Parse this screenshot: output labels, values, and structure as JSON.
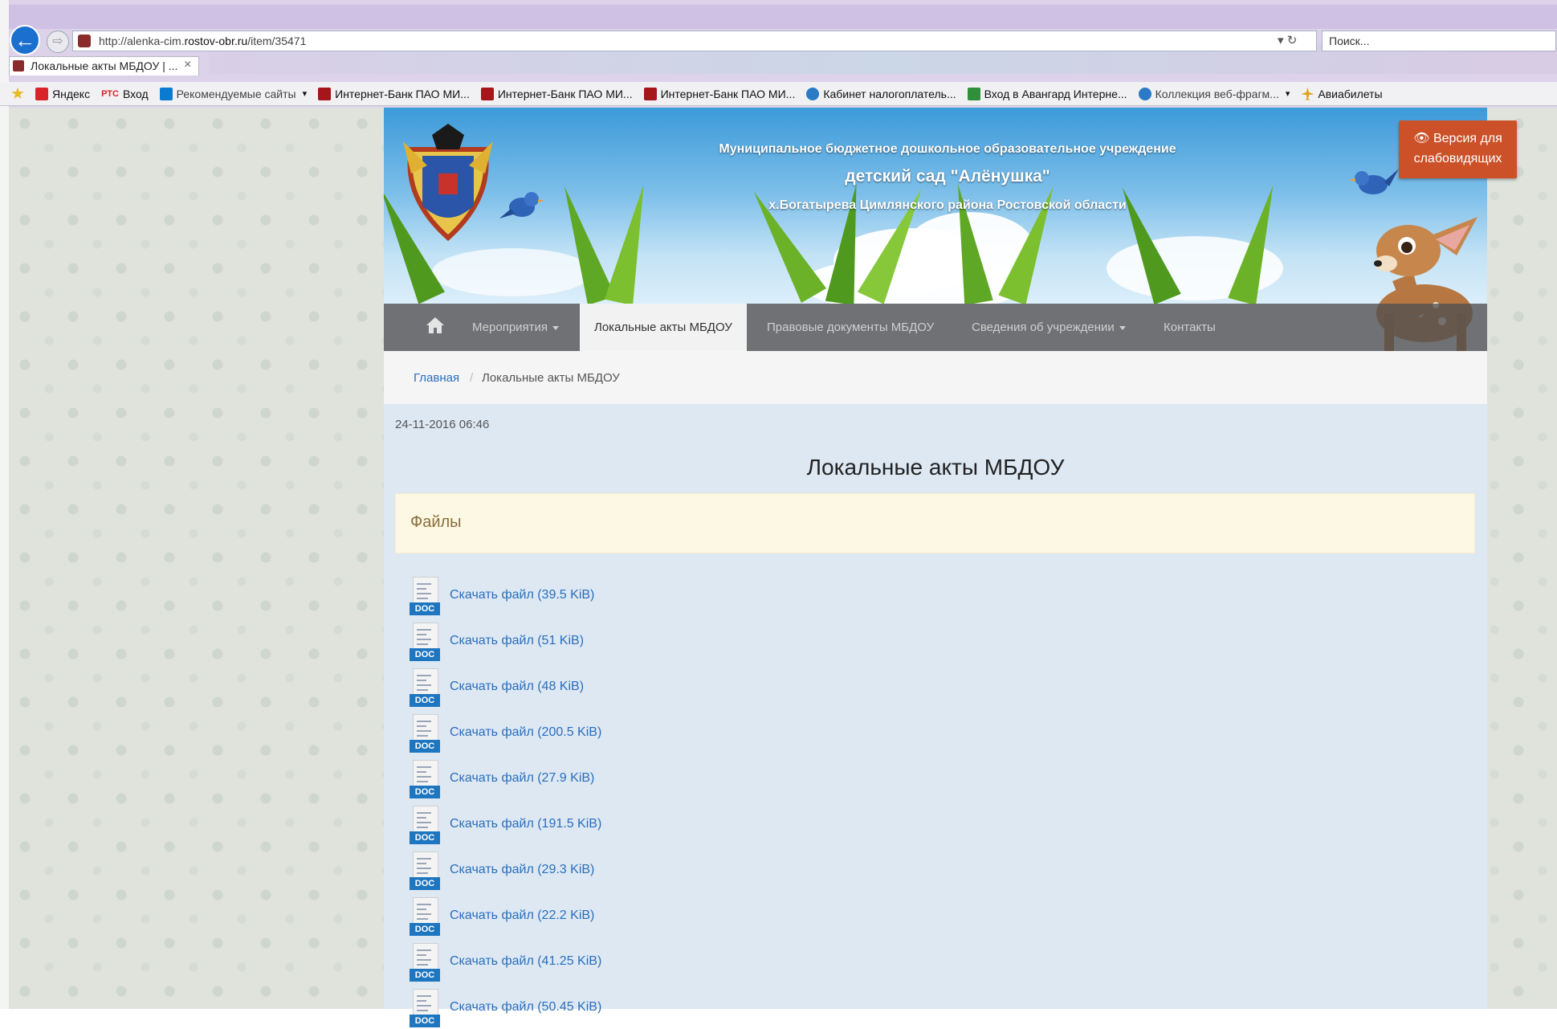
{
  "browser": {
    "url_prefix": "http://alenka-cim.",
    "url_host": "rostov-obr.ru",
    "url_path": "/item/35471",
    "search_placeholder": "Поиск...",
    "tab_title": "Локальные акты МБДОУ | ...",
    "tab_close": "×",
    "back_glyph": "←",
    "forward_glyph": "⇨",
    "address_controls": "▾ ↻",
    "favorites": [
      {
        "label": "Яндекс",
        "icon": "yandex-icon",
        "color": "#d8232a"
      },
      {
        "label": "Вход",
        "icon": "rtc-icon",
        "color": "#d8232a",
        "prefix": "РТС"
      },
      {
        "label": "Рекомендуемые сайты",
        "icon": "bing-icon",
        "color": "#0a7bd0"
      },
      {
        "label": "Интернет-Банк ПАО МИ...",
        "icon": "bank-icon",
        "color": "#a4161a"
      },
      {
        "label": "Интернет-Банк ПАО МИ...",
        "icon": "bank-icon",
        "color": "#a4161a"
      },
      {
        "label": "Интернет-Банк ПАО МИ...",
        "icon": "bank-icon",
        "color": "#a4161a"
      },
      {
        "label": "Кабинет налогоплатель...",
        "icon": "tax-icon",
        "color": "#2a7ac7"
      },
      {
        "label": "Вход в Авангард Интерне...",
        "icon": "avangard-icon",
        "color": "#2f8f3a"
      },
      {
        "label": "Коллекция веб-фрагм...",
        "icon": "ie-icon",
        "color": "#2a7ac7"
      },
      {
        "label": "Авиабилеты",
        "icon": "plane-icon",
        "color": "#e0a020"
      }
    ]
  },
  "header": {
    "line1": "Муниципальное бюджетное дошкольное образовательное учреждение",
    "line2": "детский сад \"Алёнушка\"",
    "line3": "х.Богатырева Цимлянского района Ростовской области",
    "vision_button": "👁 Версия для слабовидящих"
  },
  "nav": {
    "items": [
      "Мероприятия",
      "Локальные акты МБДОУ",
      "Правовые документы МБДОУ",
      "Сведения об учреждении",
      "Контакты"
    ]
  },
  "breadcrumb": {
    "home": "Главная",
    "separator": "/",
    "current": "Локальные акты МБДОУ"
  },
  "content": {
    "date": "24-11-2016 06:46",
    "title": "Локальные акты МБДОУ",
    "files_heading": "Файлы",
    "doc_badge": "DOC",
    "files": [
      "Скачать файл (39.5 KiB)",
      "Скачать файл (51 KiB)",
      "Скачать файл (48 KiB)",
      "Скачать файл (200.5 KiB)",
      "Скачать файл (27.9 KiB)",
      "Скачать файл (191.5 KiB)",
      "Скачать файл (29.3 KiB)",
      "Скачать файл (22.2 KiB)",
      "Скачать файл (41.25 KiB)",
      "Скачать файл (50.45 KiB)"
    ]
  },
  "colors": {
    "accent_link": "#2a6ebb",
    "vision_button": "#cc5128",
    "files_panel": "#fcf8e3",
    "content_bg": "#dde8f3"
  }
}
